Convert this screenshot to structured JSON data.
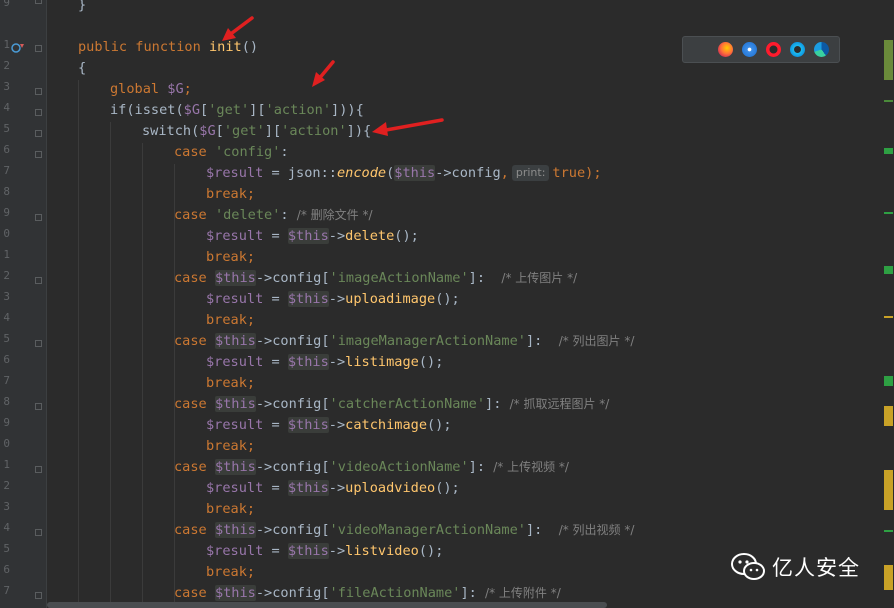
{
  "gutter": {
    "line_numbers": [
      "9",
      "",
      "1",
      "2",
      "3",
      "4",
      "5",
      "6",
      "7",
      "8",
      "9",
      "0",
      "1",
      "2",
      "3",
      "4",
      "5",
      "6",
      "7",
      "8",
      "9",
      "0",
      "1",
      "2",
      "3",
      "4",
      "5",
      "6",
      "7"
    ]
  },
  "code": {
    "tokens": {
      "close_brace": "}",
      "public": "public",
      "function": "function",
      "init": "init",
      "parens": "()",
      "open_brace": "{",
      "global": "global",
      "var_G": "$G",
      "semicolon": ";",
      "if_isset": "if(isset(",
      "bracket_open": "[",
      "bracket_mid": "][",
      "str_get": "'get'",
      "str_action": "'action'",
      "if_close": "])){",
      "switch_open": "switch(",
      "switch_close": "]){",
      "case": "case",
      "str_config": "'config'",
      "colon": ":",
      "result": "$result",
      "assign": " = ",
      "json_encode_pre": "json::",
      "encode": "encode",
      "paren_open": "(",
      "this": "$this",
      "arrow_config": "->config",
      "comma": ",",
      "hint_print": "print:",
      "true_close": "true);",
      "break": "break;",
      "str_delete": "'delete'",
      "cmt_delete": "/* 删除文件 */",
      "arrow": "->",
      "delete_call": "delete",
      "call_end": "();",
      "config_bracket": "config[",
      "bracket_colon": "]:",
      "str_image": "'imageActionName'",
      "cmt_upload_image": "/* 上传图片 */",
      "uploadimage": "uploadimage",
      "str_image_manager": "'imageManagerActionName'",
      "cmt_list_image": "/* 列出图片 */",
      "listimage": "listimage",
      "str_catcher": "'catcherActionName'",
      "cmt_catch": "/* 抓取远程图片 */",
      "catchimage": "catchimage",
      "str_video": "'videoActionName'",
      "cmt_upload_video": "/* 上传视频 */",
      "uploadvideo": "uploadvideo",
      "str_video_manager": "'videoManagerActionName'",
      "cmt_list_video": "/* 列出视频 */",
      "listvideo": "listvideo",
      "str_file": "'fileActionName'",
      "cmt_upload_file": "/* 上传附件 */"
    }
  },
  "browser_icons": [
    "chrome-icon",
    "firefox-icon",
    "safari-icon",
    "opera-icon",
    "ie-icon",
    "edge-icon"
  ],
  "watermark": {
    "text": "亿人安全"
  },
  "colors": {
    "background": "#2b2b2b",
    "keyword": "#cc7832",
    "function": "#ffc66d",
    "string": "#6a8759",
    "variable": "#9876aa",
    "comment": "#808080",
    "annotation_arrow": "#e02020"
  }
}
